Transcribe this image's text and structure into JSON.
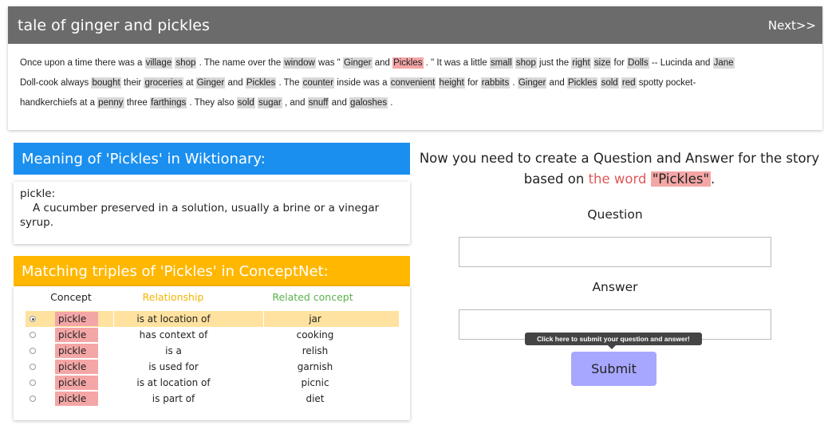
{
  "story": {
    "title": "tale of ginger and pickles",
    "next_label": "Next>>",
    "line1": [
      {
        "t": "Once upon a time there was a "
      },
      {
        "t": "village",
        "h": "grey"
      },
      {
        "t": " "
      },
      {
        "t": "shop",
        "h": "grey"
      },
      {
        "t": " . The name over the "
      },
      {
        "t": "window",
        "h": "grey"
      },
      {
        "t": " was \" "
      },
      {
        "t": "Ginger",
        "h": "grey"
      },
      {
        "t": " and "
      },
      {
        "t": "Pickles",
        "h": "red"
      },
      {
        "t": " . \" It was a little "
      },
      {
        "t": "small",
        "h": "grey"
      },
      {
        "t": " "
      },
      {
        "t": "shop",
        "h": "grey"
      },
      {
        "t": " just the "
      },
      {
        "t": "right",
        "h": "grey"
      },
      {
        "t": " "
      },
      {
        "t": "size",
        "h": "grey"
      },
      {
        "t": " for "
      },
      {
        "t": "Dolls",
        "h": "grey"
      },
      {
        "t": " -- Lucinda and "
      },
      {
        "t": "Jane",
        "h": "grey"
      }
    ],
    "line2": [
      {
        "t": "Doll-cook always "
      },
      {
        "t": "bought",
        "h": "grey"
      },
      {
        "t": " their "
      },
      {
        "t": "groceries",
        "h": "grey"
      },
      {
        "t": " at "
      },
      {
        "t": "Ginger",
        "h": "grey"
      },
      {
        "t": " and "
      },
      {
        "t": "Pickles",
        "h": "grey"
      },
      {
        "t": " . The "
      },
      {
        "t": "counter",
        "h": "grey"
      },
      {
        "t": " inside was a "
      },
      {
        "t": "convenient",
        "h": "grey"
      },
      {
        "t": " "
      },
      {
        "t": "height",
        "h": "grey"
      },
      {
        "t": " for "
      },
      {
        "t": "rabbits",
        "h": "grey"
      },
      {
        "t": " . "
      },
      {
        "t": "Ginger",
        "h": "grey"
      },
      {
        "t": " and "
      },
      {
        "t": "Pickles",
        "h": "grey"
      },
      {
        "t": " "
      },
      {
        "t": "sold",
        "h": "grey"
      },
      {
        "t": " "
      },
      {
        "t": "red",
        "h": "grey"
      },
      {
        "t": " spotty pocket-"
      }
    ],
    "line3": [
      {
        "t": "handkerchiefs at a "
      },
      {
        "t": "penny",
        "h": "grey"
      },
      {
        "t": " three "
      },
      {
        "t": "farthings",
        "h": "grey"
      },
      {
        "t": " . They also "
      },
      {
        "t": "sold",
        "h": "grey"
      },
      {
        "t": " "
      },
      {
        "t": "sugar",
        "h": "grey"
      },
      {
        "t": " , and "
      },
      {
        "t": "snuff",
        "h": "grey"
      },
      {
        "t": " and "
      },
      {
        "t": "galoshes",
        "h": "grey"
      },
      {
        "t": " ."
      }
    ]
  },
  "wiktionary": {
    "title": "Meaning of 'Pickles' in Wiktionary:",
    "term": "pickle:",
    "definition": "A cucumber preserved in a solution, usually a brine or a vinegar syrup."
  },
  "conceptnet": {
    "title": "Matching triples of 'Pickles' in ConceptNet:",
    "headers": {
      "concept": "Concept",
      "relationship": "Relationship",
      "related": "Related concept"
    },
    "rows": [
      {
        "concept": "pickle",
        "relationship": "is at location of",
        "related": "jar",
        "selected": true
      },
      {
        "concept": "pickle",
        "relationship": "has context of",
        "related": "cooking",
        "selected": false
      },
      {
        "concept": "pickle",
        "relationship": "is a",
        "related": "relish",
        "selected": false
      },
      {
        "concept": "pickle",
        "relationship": "is used for",
        "related": "garnish",
        "selected": false
      },
      {
        "concept": "pickle",
        "relationship": "is at location of",
        "related": "picnic",
        "selected": false
      },
      {
        "concept": "pickle",
        "relationship": "is part of",
        "related": "diet",
        "selected": false
      }
    ]
  },
  "task": {
    "instruction_part1": "Now you need to create a Question and Answer for the story based on ",
    "instruction_word_lead": "the word",
    "instruction_word": "\"Pickles\"",
    "instruction_end": ".",
    "question_label": "Question",
    "question_value": "",
    "answer_label": "Answer",
    "answer_value": "",
    "tooltip": "Click here to submit your question and answer!",
    "submit_label": "Submit"
  },
  "colors": {
    "header_grey": "#6b6b6b",
    "wiktionary_blue": "#1a8fef",
    "conceptnet_orange": "#ffb700",
    "target_highlight": "#f4a6a6",
    "word_highlight": "#d9d9d9",
    "submit_purple": "#a7a7ff"
  }
}
